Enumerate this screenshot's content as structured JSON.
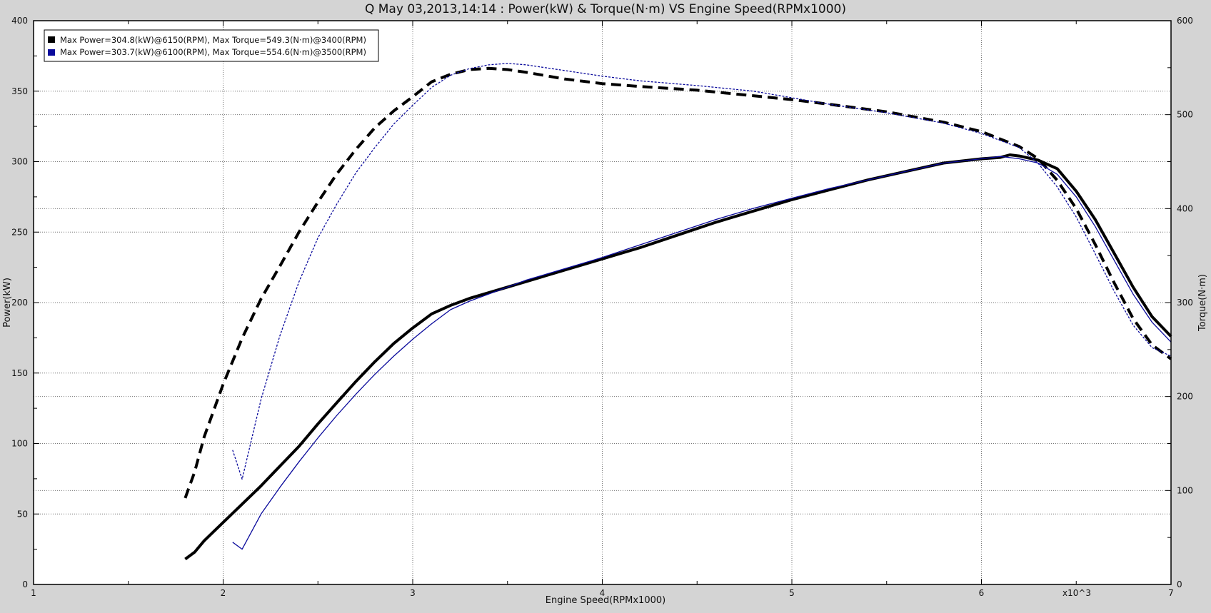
{
  "chart_data": {
    "type": "line",
    "title": "Q May 03,2013,14:14  : Power(kW) & Torque(N·m) VS Engine Speed(RPMx1000)",
    "xlabel": "Engine Speed(RPMx1000)",
    "ylabel_left": "Power(kW)",
    "ylabel_right": "Torque(N·m)",
    "x_multiplier_label": "x10^3",
    "xlim": [
      1,
      7
    ],
    "ylim_left": [
      0,
      400
    ],
    "ylim_right": [
      0,
      600
    ],
    "x_ticks": [
      1,
      2,
      3,
      4,
      5,
      6,
      7
    ],
    "y_ticks_left": [
      0,
      50,
      100,
      150,
      200,
      250,
      300,
      350,
      400
    ],
    "y_ticks_right": [
      0,
      100,
      200,
      300,
      400,
      500,
      600
    ],
    "grid": true,
    "legend_position": "top-left",
    "legend": [
      {
        "label": "Max Power=304.8(kW)@6150(RPM), Max Torque=549.3(N·m)@3400(RPM)",
        "color": "#000000"
      },
      {
        "label": "Max Power=303.7(kW)@6100(RPM), Max Torque=554.6(N·m)@3500(RPM)",
        "color": "#0a0a9c"
      }
    ],
    "series": [
      {
        "axis": "left",
        "color": "#000000",
        "width": 4,
        "dash": "",
        "x": [
          1.8,
          1.85,
          1.9,
          2.0,
          2.1,
          2.2,
          2.3,
          2.4,
          2.5,
          2.6,
          2.7,
          2.8,
          2.9,
          3.0,
          3.1,
          3.2,
          3.3,
          3.4,
          3.5,
          3.6,
          3.7,
          3.8,
          3.9,
          4.0,
          4.2,
          4.4,
          4.6,
          4.8,
          5.0,
          5.2,
          5.4,
          5.6,
          5.8,
          6.0,
          6.1,
          6.15,
          6.2,
          6.3,
          6.4,
          6.5,
          6.6,
          6.7,
          6.8,
          6.9,
          7.0
        ],
        "y": [
          18,
          23,
          31,
          44,
          57,
          70,
          84,
          98,
          114,
          129,
          144,
          158,
          171,
          182,
          192,
          198,
          203,
          207,
          211,
          215,
          219,
          223,
          227,
          231,
          239,
          248,
          257,
          265,
          273,
          280,
          287,
          293,
          299,
          302,
          303,
          304.8,
          304,
          301,
          295,
          279,
          259,
          235,
          211,
          190,
          176
        ]
      },
      {
        "axis": "right",
        "color": "#000000",
        "width": 4,
        "dash": "14 8",
        "x": [
          1.8,
          1.85,
          1.9,
          2.0,
          2.1,
          2.2,
          2.3,
          2.4,
          2.5,
          2.6,
          2.7,
          2.8,
          2.9,
          3.0,
          3.1,
          3.2,
          3.3,
          3.4,
          3.5,
          3.6,
          3.8,
          4.0,
          4.2,
          4.5,
          4.8,
          5.0,
          5.2,
          5.5,
          5.8,
          6.0,
          6.2,
          6.3,
          6.4,
          6.5,
          6.6,
          6.7,
          6.8,
          6.9,
          7.0
        ],
        "y": [
          92,
          120,
          157,
          213,
          262,
          304,
          339,
          375,
          407,
          437,
          463,
          486,
          504,
          519,
          535,
          543,
          548,
          549.3,
          548,
          545,
          538,
          533,
          530,
          526,
          520,
          516,
          511,
          503,
          492,
          482,
          466,
          453,
          430,
          400,
          362,
          321,
          283,
          255,
          240
        ]
      },
      {
        "axis": "left",
        "color": "#0a0a9c",
        "width": 1.3,
        "dash": "",
        "x": [
          2.05,
          2.1,
          2.2,
          2.3,
          2.4,
          2.5,
          2.6,
          2.7,
          2.8,
          2.9,
          3.0,
          3.1,
          3.2,
          3.3,
          3.4,
          3.5,
          3.6,
          3.7,
          3.8,
          3.9,
          4.0,
          4.2,
          4.4,
          4.6,
          4.8,
          5.0,
          5.2,
          5.4,
          5.6,
          5.8,
          6.0,
          6.1,
          6.2,
          6.3,
          6.4,
          6.5,
          6.6,
          6.7,
          6.8,
          6.9,
          7.0
        ],
        "y": [
          30,
          25,
          50,
          69,
          87,
          104,
          120,
          135,
          149,
          162,
          174,
          185,
          195,
          201,
          206,
          211,
          216,
          220,
          224,
          228,
          232,
          241,
          250,
          259,
          267,
          274,
          281,
          287,
          293,
          299,
          302,
          303.7,
          302,
          299,
          291,
          275,
          254,
          230,
          206,
          186,
          172
        ]
      },
      {
        "axis": "right",
        "color": "#0a0a9c",
        "width": 1.3,
        "dash": "3 2",
        "x": [
          2.05,
          2.1,
          2.2,
          2.3,
          2.4,
          2.5,
          2.6,
          2.7,
          2.8,
          2.9,
          3.0,
          3.1,
          3.2,
          3.3,
          3.4,
          3.5,
          3.6,
          3.8,
          4.0,
          4.2,
          4.5,
          4.8,
          5.0,
          5.2,
          5.5,
          5.8,
          6.0,
          6.2,
          6.3,
          6.4,
          6.5,
          6.6,
          6.7,
          6.8,
          6.9,
          7.0
        ],
        "y": [
          143,
          112,
          197,
          265,
          322,
          369,
          405,
          438,
          465,
          490,
          510,
          529,
          542,
          549,
          553,
          554.6,
          553,
          547,
          541,
          536,
          531,
          525,
          518,
          511,
          502,
          491,
          480,
          465,
          448,
          423,
          391,
          352,
          312,
          276,
          252,
          243
        ]
      }
    ]
  }
}
